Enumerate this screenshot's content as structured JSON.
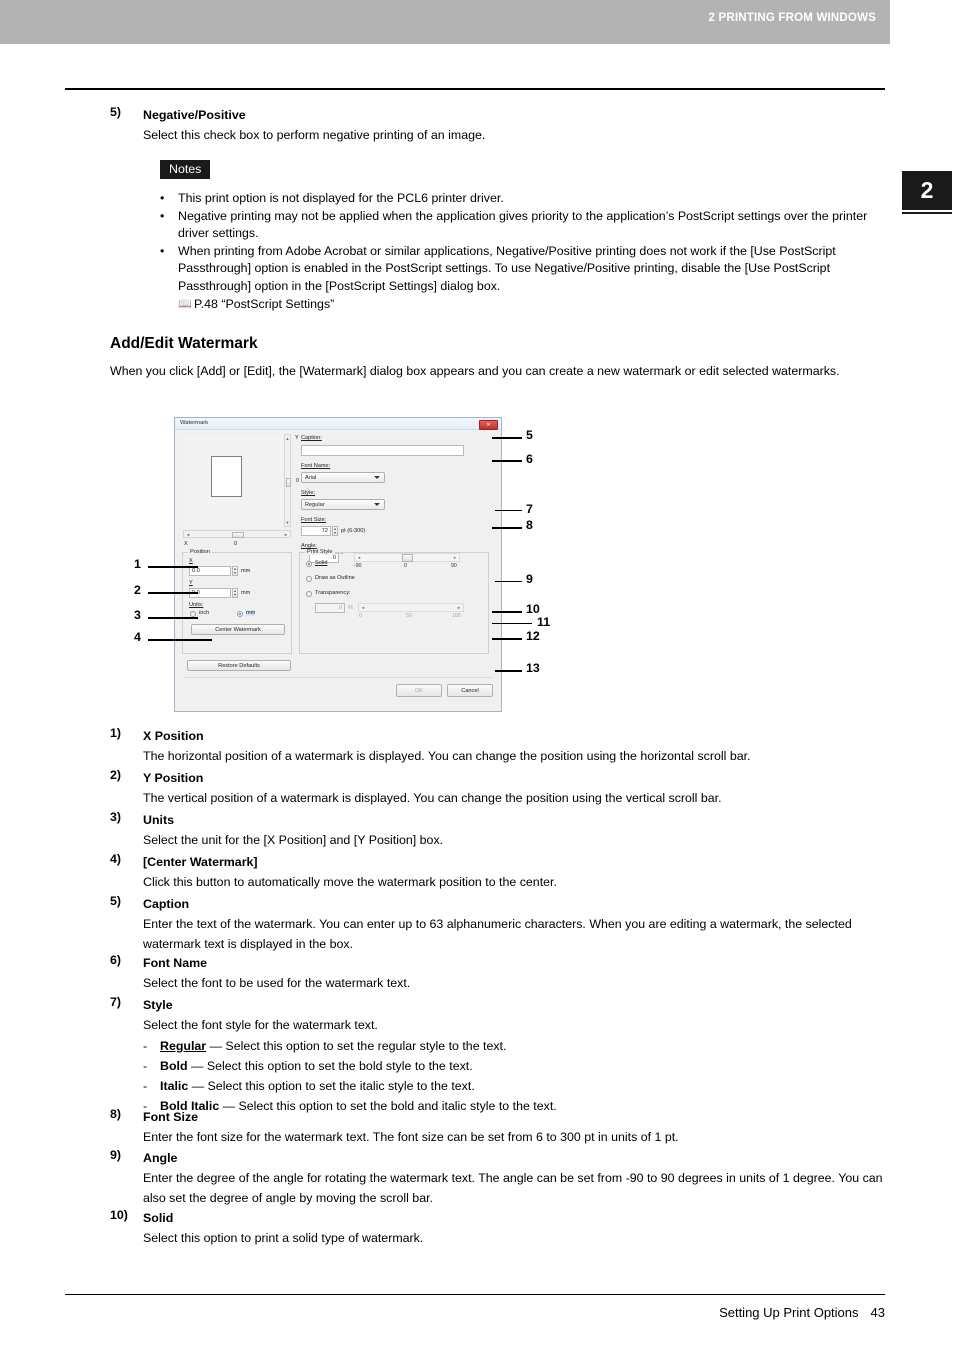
{
  "header": {
    "running_head": "2 PRINTING FROM WINDOWS",
    "chapter_tab": "2"
  },
  "intro_item": {
    "marker": "5)",
    "title": "Negative/Positive",
    "desc": "Select this check box to perform negative printing of an image."
  },
  "notes": {
    "badge": "Notes",
    "bullet_char": "•",
    "items": [
      "This print option is not displayed for the PCL6 printer driver.",
      "Negative printing may not be applied when the application gives priority to the application’s PostScript settings over the printer driver settings.",
      "When printing from Adobe Acrobat or similar applications, Negative/Positive printing does not work if the [Use PostScript Passthrough] option is enabled in the PostScript settings. To use Negative/Positive printing, disable the [Use PostScript Passthrough] option in the [PostScript Settings] dialog box."
    ],
    "reference": "P.48 “PostScript Settings”",
    "reference_icon": "book-icon"
  },
  "section": {
    "heading": "Add/Edit Watermark",
    "paragraph": "When you click [Add] or [Edit], the [Watermark] dialog box appears and you can create a new watermark or edit selected watermarks."
  },
  "dialog": {
    "title": "Watermark",
    "close_glyph": "✕",
    "preview": {
      "axis_y_label": "Y",
      "axis_y_value": "0",
      "axis_x_label": "X",
      "axis_x_value": "0",
      "scroll_up_glyph": "▲",
      "scroll_down_glyph": "▼",
      "scroll_left_glyph": "◄",
      "scroll_right_glyph": "►"
    },
    "position_group": {
      "legend": "Position",
      "x_label": "X",
      "x_value": "0.0",
      "x_unit": "mm",
      "y_label": "Y",
      "y_value": "0.0",
      "y_unit": "mm",
      "units_label": "Units:",
      "unit_inch": "inch",
      "unit_mm": "mm",
      "unit_selected": "mm",
      "center_button": "Center Watermark",
      "spinner_up": "▲",
      "spinner_down": "▼"
    },
    "restore_defaults_button": "Restore Defaults",
    "caption": {
      "label": "Caption:",
      "value": ""
    },
    "font_name": {
      "label": "Font Name:",
      "value": "Arial"
    },
    "style": {
      "label": "Style:",
      "value": "Regular"
    },
    "font_size": {
      "label": "Font Size:",
      "value": "72",
      "unit_hint": "pt (6-300)"
    },
    "angle": {
      "label": "Angle:",
      "value": "0",
      "degree_symbol": "°",
      "tick_min": "-90",
      "tick_mid": "0",
      "tick_max": "90"
    },
    "print_style": {
      "legend": "Print Style",
      "options": [
        {
          "label": "Solid",
          "selected": true
        },
        {
          "label": "Draw as Outline",
          "selected": false
        },
        {
          "label": "Transparency:",
          "selected": false
        }
      ],
      "transparency_value": "0",
      "transparency_unit": "%",
      "transparency_tick_min": "0",
      "transparency_tick_mid": "50",
      "transparency_tick_max": "100"
    },
    "ok_button": "OK",
    "cancel_button": "Cancel"
  },
  "callouts_left": [
    "1",
    "2",
    "3",
    "4"
  ],
  "callouts_right": [
    "5",
    "6",
    "7",
    "8",
    "9",
    "10",
    "11",
    "12",
    "13"
  ],
  "list": [
    {
      "marker": "1)",
      "title": "X Position",
      "desc": "The horizontal position of a watermark is displayed. You can change the position using the horizontal scroll bar."
    },
    {
      "marker": "2)",
      "title": "Y Position",
      "desc": "The vertical position of a watermark is displayed. You can change the position using the vertical scroll bar."
    },
    {
      "marker": "3)",
      "title": "Units",
      "desc": "Select the unit for the [X Position] and [Y Position] box."
    },
    {
      "marker": "4)",
      "title": "[Center Watermark]",
      "desc": "Click this button to automatically move the watermark position to the center."
    },
    {
      "marker": "5)",
      "title": "Caption",
      "desc": "Enter the text of the watermark. You can enter up to 63 alphanumeric characters. When you are editing a watermark, the selected watermark text is displayed in the box."
    },
    {
      "marker": "6)",
      "title": "Font Name",
      "desc": "Select the font to be used for the watermark text."
    },
    {
      "marker": "7)",
      "title": "Style",
      "desc": "Select the font style for the watermark text."
    },
    {
      "marker": "8)",
      "title": "Font Size",
      "desc": "Enter the font size for the watermark text. The font size can be set from 6 to 300 pt in units of 1 pt."
    },
    {
      "marker": "9)",
      "title": "Angle",
      "desc": "Enter the degree of the angle for rotating the watermark text. The angle can be set from -90 to 90 degrees in units of 1 degree. You can also set the degree of angle by moving the scroll bar."
    },
    {
      "marker": "10)",
      "title": "Solid",
      "desc": "Select this option to print a solid type of watermark."
    }
  ],
  "style_sublist": {
    "dash": "-",
    "items": [
      {
        "term": "Regular",
        "underline": true,
        "desc": "— Select this option to set the regular style to the text."
      },
      {
        "term": "Bold",
        "underline": false,
        "desc": "— Select this option to set the bold style to the text."
      },
      {
        "term": "Italic",
        "underline": false,
        "desc": "— Select this option to set the italic style to the text."
      },
      {
        "term": "Bold Italic",
        "underline": false,
        "desc": "— Select this option to set the bold and italic style to the text."
      }
    ]
  },
  "footer": {
    "title": "Setting Up Print Options",
    "page_number": "43"
  }
}
